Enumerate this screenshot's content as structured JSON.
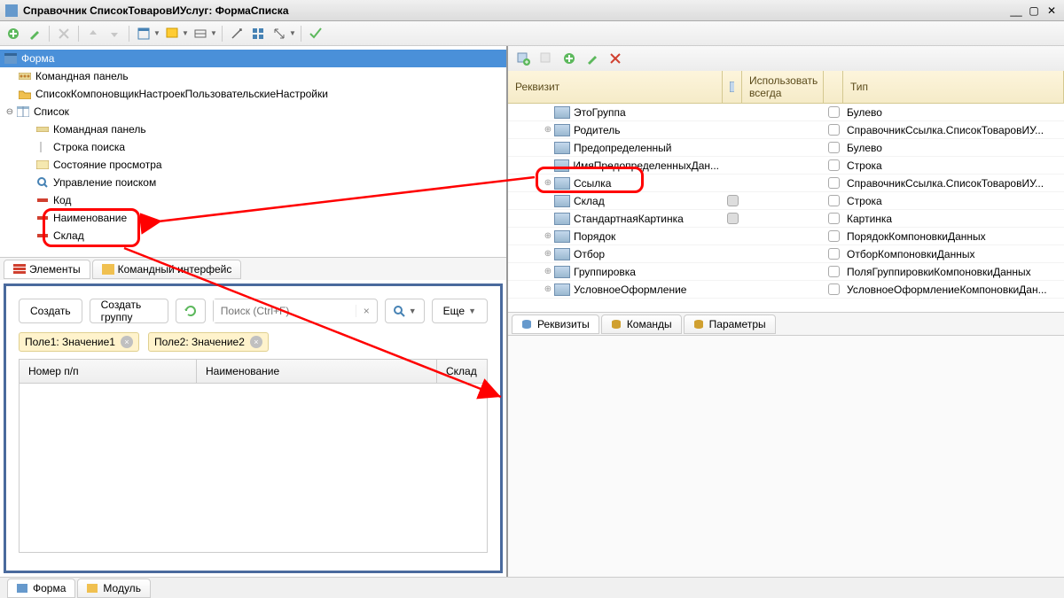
{
  "window": {
    "title": "Справочник СписокТоваровИУслуг: ФормаСписка"
  },
  "tree": {
    "root": "Форма",
    "items": {
      "cmdpanel": "Командная панель",
      "composer": "СписокКомпоновщикНастроекПользовательскиеНастройки",
      "list": "Список",
      "cmdpanel2": "Командная панель",
      "searchrow": "Строка поиска",
      "viewstate": "Состояние просмотра",
      "searchctl": "Управление поиском",
      "code": "Код",
      "name": "Наименование",
      "warehouse": "Склад"
    }
  },
  "lefttabs": {
    "elements": "Элементы",
    "cmdiface": "Командный интерфейс"
  },
  "preview": {
    "create": "Создать",
    "creategroup": "Создать группу",
    "searchplaceholder": "Поиск (Ctrl+F)",
    "more": "Еще",
    "filter1": "Поле1: Значение1",
    "filter2": "Поле2: Значение2",
    "col_num": "Номер п/п",
    "col_name": "Наименование",
    "col_wh": "Склад"
  },
  "righttabs": {
    "attrs": "Реквизиты",
    "cmds": "Команды",
    "params": "Параметры"
  },
  "attrhead": {
    "req": "Реквизит",
    "use": "Использовать всегда",
    "type": "Тип"
  },
  "attrs": [
    {
      "name": "ЭтоГруппа",
      "type": "Булево",
      "exp": ""
    },
    {
      "name": "Родитель",
      "type": "СправочникСсылка.СписокТоваровИУ...",
      "exp": "⊕"
    },
    {
      "name": "Предопределенный",
      "type": "Булево",
      "exp": ""
    },
    {
      "name": "ИмяПредопределенныхДан...",
      "type": "Строка",
      "exp": ""
    },
    {
      "name": "Ссылка",
      "type": "СправочникСсылка.СписокТоваровИУ...",
      "exp": "⊕"
    },
    {
      "name": "Склад",
      "type": "Строка",
      "exp": "",
      "hl": true,
      "c1": true
    },
    {
      "name": "СтандартнаяКартинка",
      "type": "Картинка",
      "exp": "",
      "c1": true
    },
    {
      "name": "Порядок",
      "type": "ПорядокКомпоновкиДанных",
      "exp": "⊕"
    },
    {
      "name": "Отбор",
      "type": "ОтборКомпоновкиДанных",
      "exp": "⊕"
    },
    {
      "name": "Группировка",
      "type": "ПоляГруппировкиКомпоновкиДанных",
      "exp": "⊕"
    },
    {
      "name": "УсловноеОформление",
      "type": "УсловноеОформлениеКомпоновкиДан...",
      "exp": "⊕"
    }
  ],
  "bottomtabs": {
    "form": "Форма",
    "module": "Модуль"
  }
}
